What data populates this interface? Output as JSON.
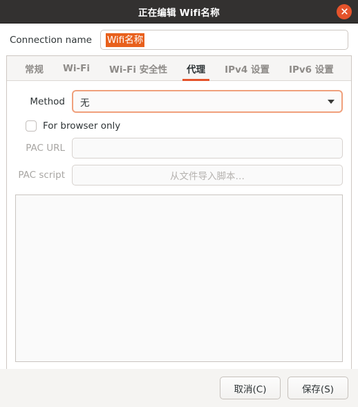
{
  "titlebar": {
    "title": "正在编辑 Wifi名称",
    "close_icon": "close-icon"
  },
  "connection": {
    "label": "Connection name",
    "value": "Wifi名称",
    "placeholder": ""
  },
  "tabs": [
    {
      "label": "常规",
      "active": false
    },
    {
      "label": "Wi-Fi",
      "active": false
    },
    {
      "label": "Wi-Fi 安全性",
      "active": false
    },
    {
      "label": "代理",
      "active": true
    },
    {
      "label": "IPv4 设置",
      "active": false
    },
    {
      "label": "IPv6 设置",
      "active": false
    }
  ],
  "proxy": {
    "method_label": "Method",
    "method_value": "无",
    "browser_only_label": "For browser only",
    "browser_only_checked": false,
    "pac_url_label": "PAC URL",
    "pac_url_value": "",
    "pac_url_placeholder": "",
    "pac_script_label": "PAC script",
    "pac_script_value": "从文件导入脚本…",
    "script_content": ""
  },
  "footer": {
    "cancel_label": "取消(C)",
    "save_label": "保存(S)"
  },
  "colors": {
    "accent": "#e5532b",
    "selection": "#e8601c",
    "titlebar_bg": "#333130",
    "focus_border": "#f0a07c"
  }
}
